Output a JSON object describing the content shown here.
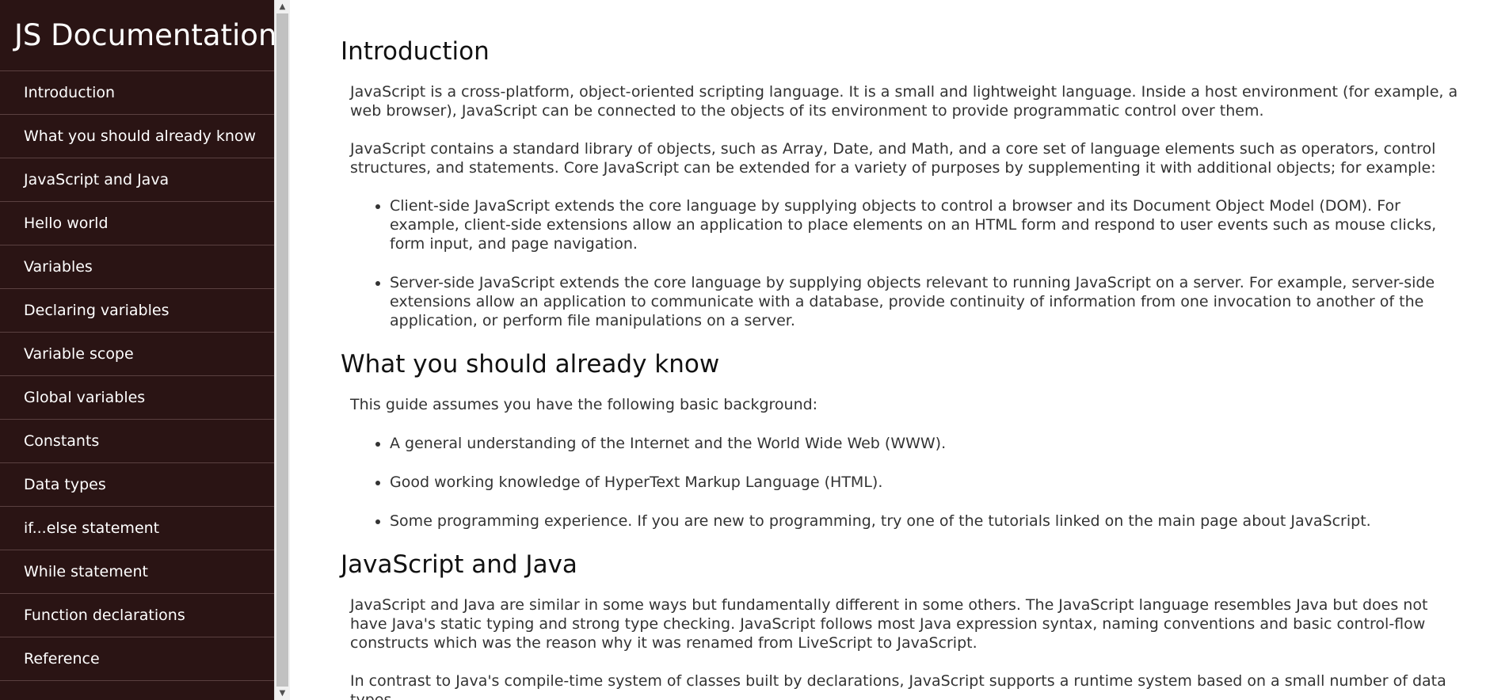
{
  "nav": {
    "title": "JS Documentation",
    "items": [
      {
        "label": "Introduction"
      },
      {
        "label": "What you should already know"
      },
      {
        "label": "JavaScript and Java"
      },
      {
        "label": "Hello world"
      },
      {
        "label": "Variables"
      },
      {
        "label": "Declaring variables"
      },
      {
        "label": "Variable scope"
      },
      {
        "label": "Global variables"
      },
      {
        "label": "Constants"
      },
      {
        "label": "Data types"
      },
      {
        "label": "if...else statement"
      },
      {
        "label": "While statement"
      },
      {
        "label": "Function declarations"
      },
      {
        "label": "Reference"
      }
    ]
  },
  "sections": {
    "introduction": {
      "header": "Introduction",
      "p1": "JavaScript is a cross-platform, object-oriented scripting language. It is a small and lightweight language. Inside a host environment (for example, a web browser), JavaScript can be connected to the objects of its environment to provide programmatic control over them.",
      "p2": "JavaScript contains a standard library of objects, such as Array, Date, and Math, and a core set of language elements such as operators, control structures, and statements. Core JavaScript can be extended for a variety of purposes by supplementing it with additional objects; for example:",
      "bullets": [
        "Client-side JavaScript extends the core language by supplying objects to control a browser and its Document Object Model (DOM). For example, client-side extensions allow an application to place elements on an HTML form and respond to user events such as mouse clicks, form input, and page navigation.",
        "Server-side JavaScript extends the core language by supplying objects relevant to running JavaScript on a server. For example, server-side extensions allow an application to communicate with a database, provide continuity of information from one invocation to another of the application, or perform file manipulations on a server."
      ]
    },
    "what_you_should_already_know": {
      "header": "What you should already know",
      "p1": "This guide assumes you have the following basic background:",
      "bullets": [
        "A general understanding of the Internet and the World Wide Web (WWW).",
        "Good working knowledge of HyperText Markup Language (HTML).",
        "Some programming experience. If you are new to programming, try one of the tutorials linked on the main page about JavaScript."
      ]
    },
    "javascript_and_java": {
      "header": "JavaScript and Java",
      "p1": "JavaScript and Java are similar in some ways but fundamentally different in some others. The JavaScript language resembles Java but does not have Java's static typing and strong type checking. JavaScript follows most Java expression syntax, naming conventions and basic control-flow constructs which was the reason why it was renamed from LiveScript to JavaScript.",
      "p2": "In contrast to Java's compile-time system of classes built by declarations, JavaScript supports a runtime system based on a small number of data types"
    }
  },
  "scrollbar": {
    "up_icon": "triangle-up-icon",
    "down_icon": "triangle-down-icon"
  }
}
